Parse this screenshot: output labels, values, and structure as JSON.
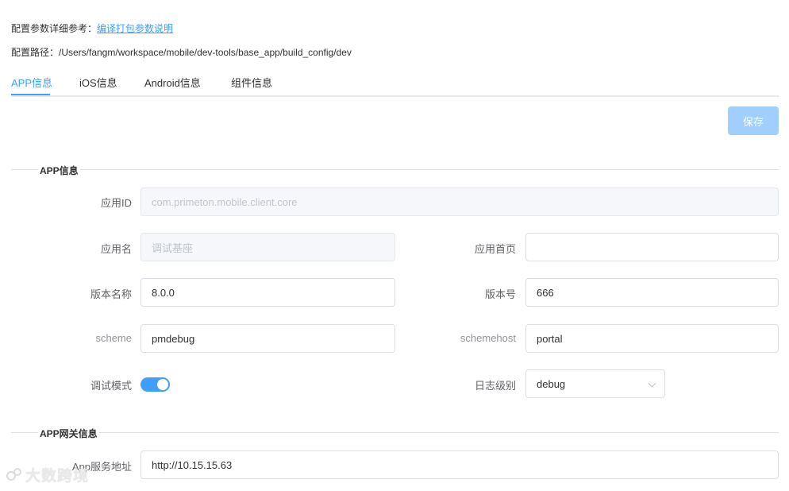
{
  "ref": {
    "label": "配置参数详细参考：",
    "link": "编译打包参数说明"
  },
  "config_path": "配置路径：/Users/fangm/workspace/mobile/dev-tools/base_app/build_config/dev",
  "tabs": [
    {
      "label": "APP信息",
      "active": true
    },
    {
      "label": "iOS信息",
      "active": false
    },
    {
      "label": "Android信息",
      "active": false
    },
    {
      "label": "组件信息",
      "active": false
    }
  ],
  "save_label": "保存",
  "section_app": "APP信息",
  "section_gateway": "APP网关信息",
  "fields": {
    "app_id": {
      "label": "应用ID",
      "value": "com.primeton.mobile.client.core",
      "disabled": true
    },
    "app_name": {
      "label": "应用名",
      "value": "调试基座",
      "disabled": true
    },
    "home_page": {
      "label": "应用首页",
      "value": ""
    },
    "version_name": {
      "label": "版本名称",
      "value": "8.0.0"
    },
    "version_code": {
      "label": "版本号",
      "value": "666"
    },
    "scheme": {
      "label": "scheme",
      "value": "pmdebug"
    },
    "scheme_host": {
      "label": "schemehost",
      "value": "portal"
    },
    "debug_mode": {
      "label": "调试模式",
      "on": true
    },
    "log_level": {
      "label": "日志级别",
      "value": "debug"
    },
    "service_address": {
      "label": "App服务地址",
      "value": "http://10.15.15.63"
    }
  },
  "watermark": "大数跨境",
  "colors": {
    "accent": "#409eff",
    "disabled_button": "#a0cfff"
  }
}
